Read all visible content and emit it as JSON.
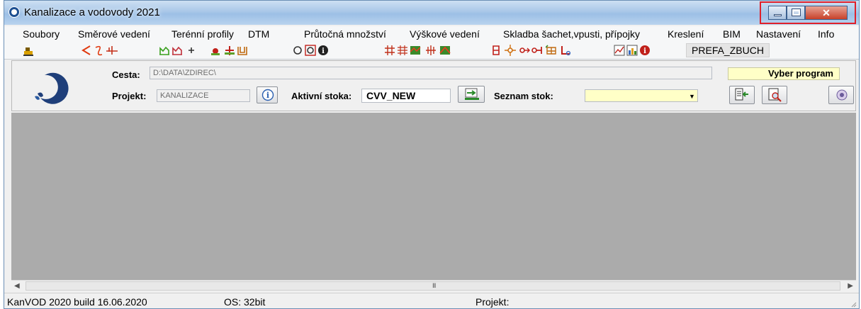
{
  "window": {
    "title": "Kanalizace a vodovody 2021"
  },
  "menu": [
    {
      "label": "Soubory"
    },
    {
      "label": "Směrové vedení"
    },
    {
      "label": "Terénní profily"
    },
    {
      "label": "DTM"
    },
    {
      "label": "Průtočná množství"
    },
    {
      "label": "Výškové vedení"
    },
    {
      "label": "Skladba šachet,vpusti, přípojky"
    },
    {
      "label": "Kreslení"
    },
    {
      "label": "BIM"
    },
    {
      "label": "Nastavení"
    },
    {
      "label": "Info"
    }
  ],
  "toolbar": {
    "prefa_label": "PREFA_ZBUCH"
  },
  "panel": {
    "cesta_label": "Cesta:",
    "cesta_value": "D:\\DATA\\ZDIREC\\",
    "projekt_label": "Projekt:",
    "projekt_value": "KANALIZACE",
    "aktivni_label": "Aktivní stoka:",
    "aktivni_value": "CVV_NEW",
    "seznam_label": "Seznam stok:",
    "seznam_value": "",
    "vyber_label": "Vyber program"
  },
  "hscroll": {
    "grip": "III"
  },
  "status": {
    "version": "KanVOD 2020 build 16.06.2020",
    "os": "OS:  32bit",
    "projekt": "Projekt:"
  },
  "colors": {
    "workarea": "#ababab",
    "accent_red": "#e0202a",
    "yellow_field": "#ffffc7"
  }
}
